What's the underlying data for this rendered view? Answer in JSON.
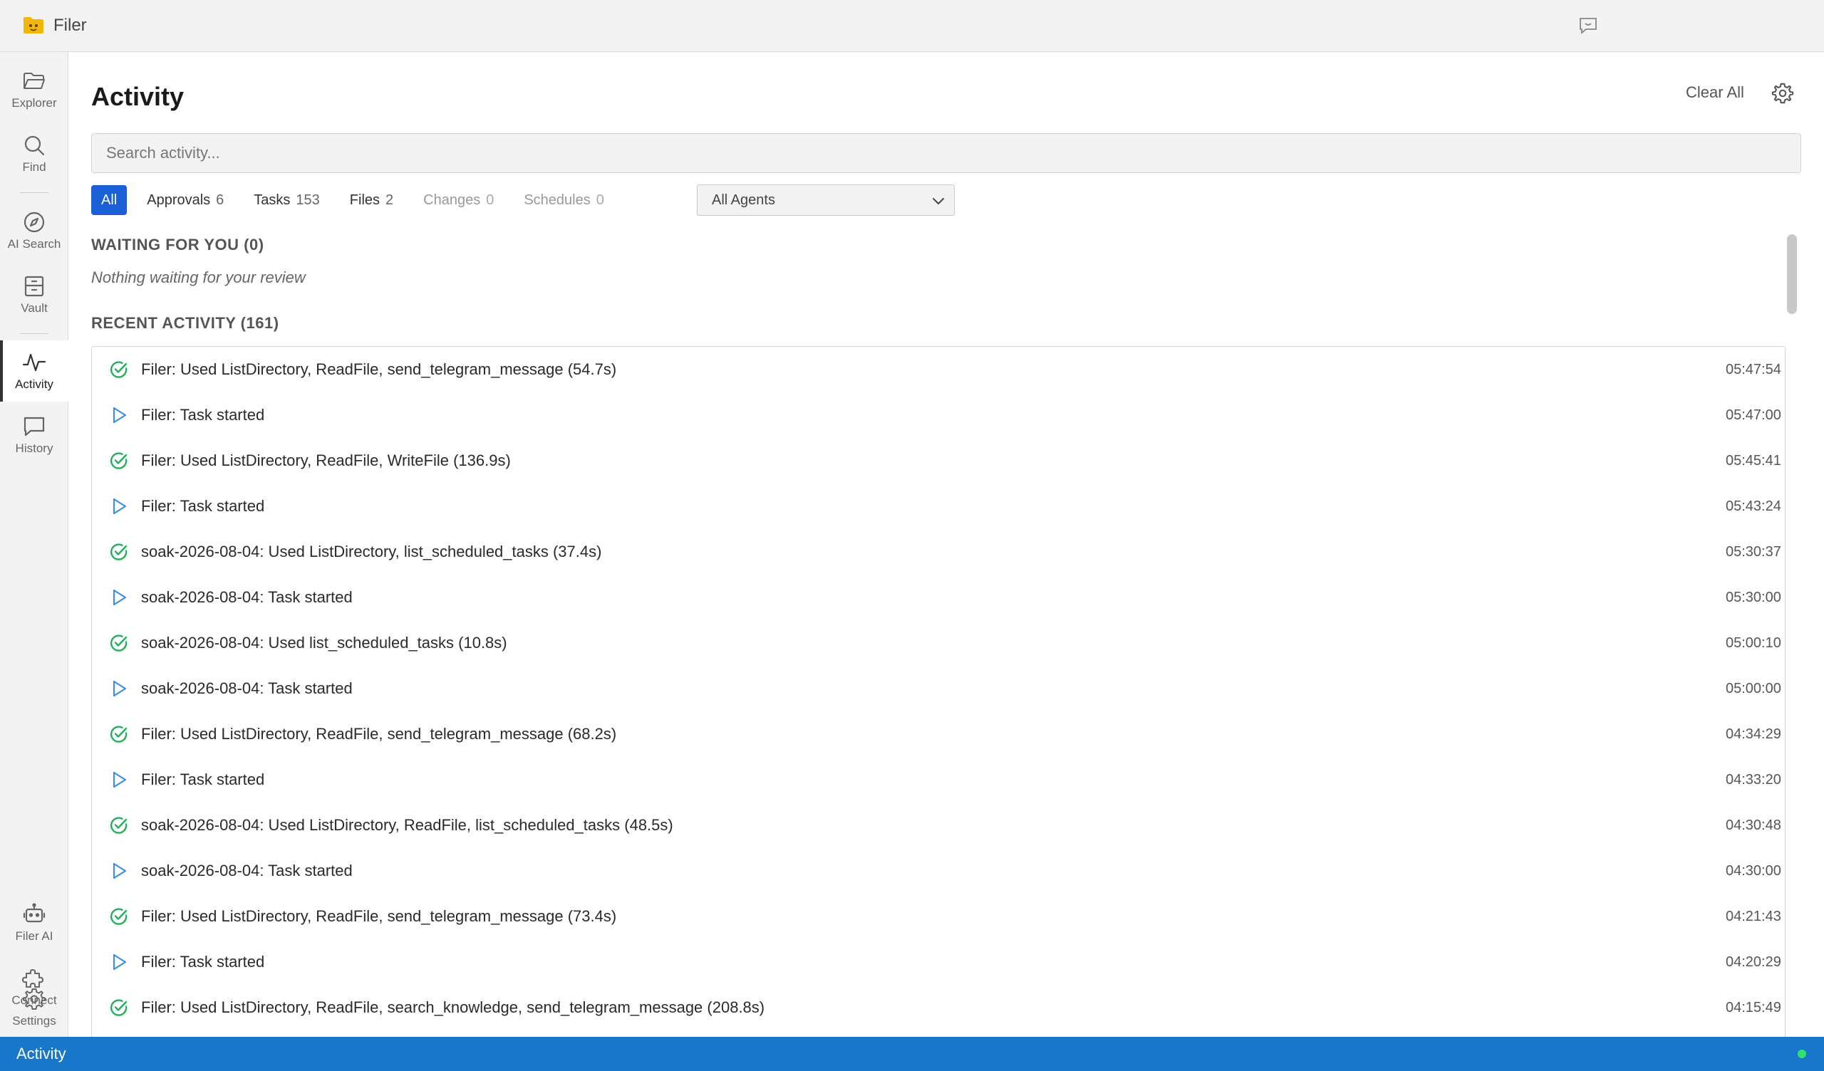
{
  "app": {
    "title": "Filer"
  },
  "sidebar": {
    "items": [
      {
        "label": "Explorer",
        "icon": "folder-icon"
      },
      {
        "label": "Find",
        "icon": "search-icon"
      },
      {
        "label": "AI Search",
        "icon": "compass-icon"
      },
      {
        "label": "Vault",
        "icon": "vault-icon"
      },
      {
        "label": "Activity",
        "icon": "activity-icon",
        "active": true
      },
      {
        "label": "History",
        "icon": "chat-bubble-icon"
      },
      {
        "label": "Filer AI",
        "icon": "robot-icon"
      },
      {
        "label": "Connect",
        "icon": "puzzle-icon"
      },
      {
        "label": "Settings",
        "icon": "gear-icon"
      }
    ]
  },
  "main": {
    "title": "Activity",
    "clear_all_label": "Clear All",
    "search_placeholder": "Search activity...",
    "filters": [
      {
        "label": "All",
        "count": "",
        "active": true
      },
      {
        "label": "Approvals",
        "count": "6"
      },
      {
        "label": "Tasks",
        "count": "153"
      },
      {
        "label": "Files",
        "count": "2"
      },
      {
        "label": "Changes",
        "count": "0",
        "disabled": true
      },
      {
        "label": "Schedules",
        "count": "0",
        "disabled": true
      }
    ],
    "agent_select": {
      "selected": "All Agents"
    },
    "waiting": {
      "title": "WAITING FOR YOU (0)",
      "empty_text": "Nothing waiting for your review"
    },
    "recent": {
      "title": "RECENT ACTIVITY (161)",
      "rows": [
        {
          "status": "completed",
          "text": "Filer: Used ListDirectory, ReadFile, send_telegram_message (54.7s)",
          "time": "05:47:54 PM"
        },
        {
          "status": "started",
          "text": "Filer: Task started",
          "time": "05:47:00 PM"
        },
        {
          "status": "completed",
          "text": "Filer: Used ListDirectory, ReadFile, WriteFile (136.9s)",
          "time": "05:45:41 PM"
        },
        {
          "status": "started",
          "text": "Filer: Task started",
          "time": "05:43:24 PM"
        },
        {
          "status": "completed",
          "text": "soak-2026-08-04: Used ListDirectory, list_scheduled_tasks (37.4s)",
          "time": "05:30:37 PM"
        },
        {
          "status": "started",
          "text": "soak-2026-08-04: Task started",
          "time": "05:30:00 PM"
        },
        {
          "status": "completed",
          "text": "soak-2026-08-04: Used list_scheduled_tasks (10.8s)",
          "time": "05:00:10 PM"
        },
        {
          "status": "started",
          "text": "soak-2026-08-04: Task started",
          "time": "05:00:00 PM"
        },
        {
          "status": "completed",
          "text": "Filer: Used ListDirectory, ReadFile, send_telegram_message (68.2s)",
          "time": "04:34:29 PM"
        },
        {
          "status": "started",
          "text": "Filer: Task started",
          "time": "04:33:20 PM"
        },
        {
          "status": "completed",
          "text": "soak-2026-08-04: Used ListDirectory, ReadFile, list_scheduled_tasks (48.5s)",
          "time": "04:30:48 PM"
        },
        {
          "status": "started",
          "text": "soak-2026-08-04: Task started",
          "time": "04:30:00 PM"
        },
        {
          "status": "completed",
          "text": "Filer: Used ListDirectory, ReadFile, send_telegram_message (73.4s)",
          "time": "04:21:43 PM"
        },
        {
          "status": "started",
          "text": "Filer: Task started",
          "time": "04:20:29 PM"
        },
        {
          "status": "completed",
          "text": "Filer: Used ListDirectory, ReadFile, search_knowledge, send_telegram_message (208.8s)",
          "time": "04:15:49 PM"
        }
      ]
    }
  },
  "statusbar": {
    "label": "Activity"
  },
  "colors": {
    "accent": "#1a5fd6",
    "statusbar": "#1877c8",
    "success": "#22b15a",
    "started": "#3b8ee0",
    "online": "#2ee36b"
  }
}
